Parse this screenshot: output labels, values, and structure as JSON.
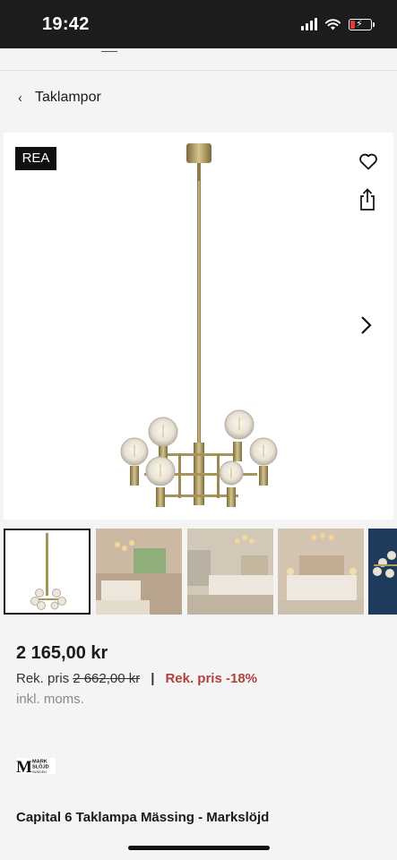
{
  "status": {
    "time": "19:42"
  },
  "breadcrumb": {
    "label": "Taklampor"
  },
  "product": {
    "badge": "REA",
    "price": "2 165,00 kr",
    "rek_prefix": "Rek. pris",
    "rek_price": "2 662,00 kr",
    "separator": "|",
    "discount": "Rek. pris -18%",
    "vat": "inkl. moms.",
    "title": "Capital 6 Taklampa Mässing - Markslöjd"
  },
  "brand": {
    "logo_lines": [
      "MARK",
      "SLÖJD",
      "SWEDEN"
    ]
  },
  "icons": {
    "back": "chevron-left-icon",
    "favorite": "heart-icon",
    "share": "share-icon",
    "next": "chevron-right-icon"
  },
  "colors": {
    "discount": "#b0413e",
    "badge_bg": "#111111",
    "status_bar": "#1c1c1c"
  }
}
